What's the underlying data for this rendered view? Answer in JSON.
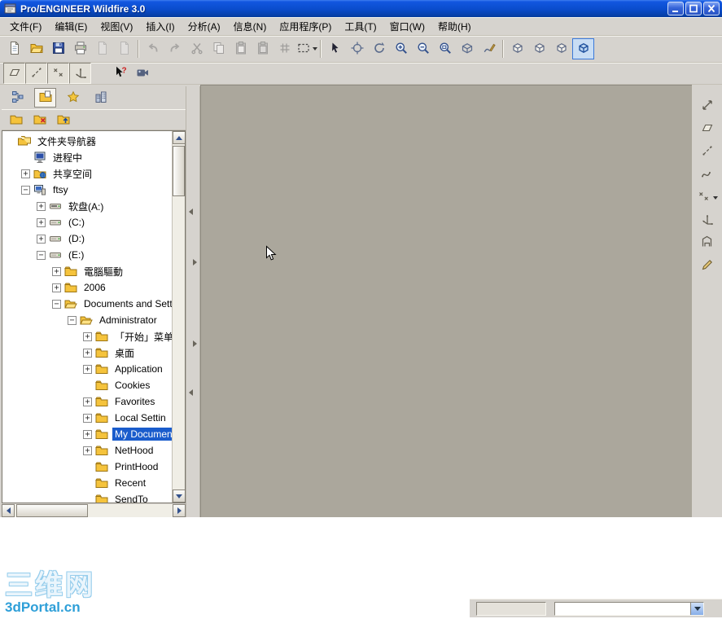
{
  "window": {
    "title": "Pro/ENGINEER Wildfire 3.0"
  },
  "menubar": {
    "items": [
      {
        "name": "menu-file",
        "label": "文件(F)"
      },
      {
        "name": "menu-edit",
        "label": "编辑(E)"
      },
      {
        "name": "menu-view",
        "label": "视图(V)"
      },
      {
        "name": "menu-insert",
        "label": "插入(I)"
      },
      {
        "name": "menu-analysis",
        "label": "分析(A)"
      },
      {
        "name": "menu-info",
        "label": "信息(N)"
      },
      {
        "name": "menu-applications",
        "label": "应用程序(P)"
      },
      {
        "name": "menu-tools",
        "label": "工具(T)"
      },
      {
        "name": "menu-window",
        "label": "窗口(W)"
      },
      {
        "name": "menu-help",
        "label": "帮助(H)"
      }
    ]
  },
  "toolbar_main": [
    {
      "name": "new-file-button",
      "icon": "page"
    },
    {
      "name": "open-file-button",
      "icon": "folder-open"
    },
    {
      "name": "save-button",
      "icon": "floppy"
    },
    {
      "name": "print-button",
      "icon": "printer"
    },
    {
      "name": "save-copy-button",
      "icon": "page-gray",
      "disabled": true
    },
    {
      "name": "email-button",
      "icon": "page-gray",
      "disabled": true
    },
    {
      "sep": true
    },
    {
      "name": "undo-button",
      "icon": "undo",
      "disabled": true
    },
    {
      "name": "redo-button",
      "icon": "redo",
      "disabled": true
    },
    {
      "name": "cut-button",
      "icon": "scissors",
      "disabled": true
    },
    {
      "name": "copy-button",
      "icon": "copy",
      "disabled": true
    },
    {
      "name": "paste-button",
      "icon": "paste",
      "disabled": true
    },
    {
      "name": "paste-special-button",
      "icon": "paste-special",
      "disabled": true
    },
    {
      "name": "regenerate-button",
      "icon": "regen",
      "disabled": true
    },
    {
      "name": "selection-filter-button",
      "icon": "dashed-box",
      "dropdown": true
    },
    {
      "sep": true
    },
    {
      "name": "select-items-button",
      "icon": "pointer"
    },
    {
      "name": "find-button",
      "icon": "crosshair"
    },
    {
      "name": "spin-center-button",
      "icon": "spin"
    },
    {
      "name": "zoom-in-button",
      "icon": "zoom-in"
    },
    {
      "name": "zoom-out-button",
      "icon": "zoom-out"
    },
    {
      "name": "refit-button",
      "icon": "refit"
    },
    {
      "name": "reorient-button",
      "icon": "orient"
    },
    {
      "name": "repaint-button",
      "icon": "redraw"
    },
    {
      "sep": true
    },
    {
      "name": "window-activate-button",
      "icon": "cube"
    },
    {
      "name": "view-manager-button",
      "icon": "cube"
    },
    {
      "name": "display-style-button",
      "icon": "cube"
    },
    {
      "name": "datum-display-button",
      "icon": "cube-active",
      "active": true
    }
  ],
  "toolbar_datum": [
    {
      "name": "datum-planes-toggle",
      "icon": "plane",
      "toggled": true
    },
    {
      "name": "datum-axes-toggle",
      "icon": "axis",
      "toggled": true
    },
    {
      "name": "datum-points-toggle",
      "icon": "points",
      "toggled": true
    },
    {
      "name": "datum-csys-toggle",
      "icon": "csys",
      "toggled": true
    },
    {
      "gap": true
    },
    {
      "name": "context-help-button",
      "icon": "help-pointer"
    },
    {
      "name": "model-player-button",
      "icon": "camera"
    }
  ],
  "navigator": {
    "tabs": [
      {
        "name": "tab-model-tree",
        "icon": "tree-grid"
      },
      {
        "name": "tab-folder-browser",
        "icon": "folder-tab",
        "active": true
      },
      {
        "name": "tab-favorites",
        "icon": "star"
      },
      {
        "name": "tab-connections",
        "icon": "buildings"
      }
    ],
    "folderbar": [
      {
        "name": "new-folder-button",
        "icon": "folder-plain"
      },
      {
        "name": "delete-folder-button",
        "icon": "folder-x"
      },
      {
        "name": "up-one-level-button",
        "icon": "folder-up"
      }
    ],
    "tree": [
      {
        "label": "文件夹导航器",
        "level": 0,
        "exp": "",
        "icon": "t-folders"
      },
      {
        "label": "进程中",
        "level": 1,
        "exp": "",
        "icon": "t-monitor"
      },
      {
        "label": "共享空间",
        "level": 1,
        "exp": "+",
        "icon": "t-shared"
      },
      {
        "label": "ftsy",
        "level": 1,
        "exp": "-",
        "icon": "t-computer"
      },
      {
        "label": "软盘(A:)",
        "level": 2,
        "exp": "+",
        "icon": "t-floppy"
      },
      {
        "label": "(C:)",
        "level": 2,
        "exp": "+",
        "icon": "t-drive"
      },
      {
        "label": "(D:)",
        "level": 2,
        "exp": "+",
        "icon": "t-drive"
      },
      {
        "label": "(E:)",
        "level": 2,
        "exp": "-",
        "icon": "t-drive"
      },
      {
        "label": "電腦驅動",
        "level": 3,
        "exp": "+",
        "icon": "t-folder"
      },
      {
        "label": "2006",
        "level": 3,
        "exp": "+",
        "icon": "t-folder"
      },
      {
        "label": "Documents and Setti",
        "level": 3,
        "exp": "-",
        "icon": "t-folder-open"
      },
      {
        "label": "Administrator",
        "level": 4,
        "exp": "-",
        "icon": "t-folder-open"
      },
      {
        "label": "「开始」菜单",
        "level": 5,
        "exp": "+",
        "icon": "t-folder"
      },
      {
        "label": "桌面",
        "level": 5,
        "exp": "+",
        "icon": "t-folder"
      },
      {
        "label": "Application",
        "level": 5,
        "exp": "+",
        "icon": "t-folder"
      },
      {
        "label": "Cookies",
        "level": 5,
        "exp": "",
        "icon": "t-folder"
      },
      {
        "label": "Favorites",
        "level": 5,
        "exp": "+",
        "icon": "t-folder"
      },
      {
        "label": "Local Settin",
        "level": 5,
        "exp": "+",
        "icon": "t-folder"
      },
      {
        "label": "My Documents",
        "level": 5,
        "exp": "+",
        "icon": "t-folder",
        "selected": true
      },
      {
        "label": "NetHood",
        "level": 5,
        "exp": "+",
        "icon": "t-folder"
      },
      {
        "label": "PrintHood",
        "level": 5,
        "exp": "",
        "icon": "t-folder"
      },
      {
        "label": "Recent",
        "level": 5,
        "exp": "",
        "icon": "t-folder"
      },
      {
        "label": "SendTo",
        "level": 5,
        "exp": "",
        "icon": "t-folder"
      }
    ]
  },
  "right_toolbar": [
    {
      "name": "resize-tool-button",
      "icon": "arrows"
    },
    {
      "name": "datum-plane-tool-button",
      "icon": "plane"
    },
    {
      "name": "datum-axis-tool-button",
      "icon": "axis"
    },
    {
      "name": "datum-curve-tool-button",
      "icon": "curve"
    },
    {
      "name": "datum-point-tool-button",
      "icon": "points",
      "dropdown": true
    },
    {
      "name": "datum-csys-tool-button",
      "icon": "csys"
    },
    {
      "name": "analysis-tool-button",
      "icon": "gauge"
    },
    {
      "name": "sketch-tool-button",
      "icon": "sketch"
    }
  ],
  "statusbar": {
    "message_value": "",
    "filter_value": ""
  },
  "watermark": {
    "line1": "三维网",
    "line2": "3dPortal.cn"
  },
  "colors": {
    "titlebar": "#0a4ccc",
    "ui_background": "#d6d3ce",
    "canvas_background": "#aba79c",
    "selection": "#1a5ccc",
    "watermark_outline": "#96cdec",
    "watermark_text": "#2e9fd8"
  }
}
